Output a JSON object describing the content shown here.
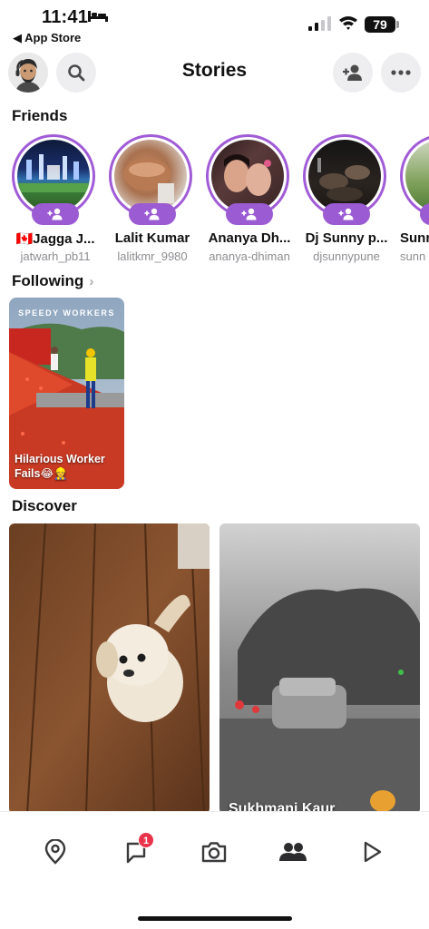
{
  "status_bar": {
    "time": "11:41",
    "back_label": "◀ App Store",
    "battery": "79"
  },
  "header": {
    "title": "Stories"
  },
  "friends_section": {
    "title": "Friends",
    "items": [
      {
        "name": "🇨🇦Jagga J...",
        "username": "jatwarh_pb11"
      },
      {
        "name": "Lalit Kumar",
        "username": "lalitkmr_9980"
      },
      {
        "name": "Ananya Dh...",
        "username": "ananya-dhiman"
      },
      {
        "name": "Dj Sunny p...",
        "username": "djsunnypune"
      },
      {
        "name": "Sunn",
        "username": "sunn"
      }
    ],
    "add_label": "+👤"
  },
  "following_section": {
    "title": "Following",
    "card": {
      "channel": "SPEEDY WORKERS",
      "caption": "Hilarious Worker Fails😂👷"
    }
  },
  "discover_section": {
    "title": "Discover",
    "cards": [
      {
        "caption": ""
      },
      {
        "caption": "Sukhmani Kaur"
      }
    ]
  },
  "bottom_nav": {
    "chat_badge": "1"
  },
  "colors": {
    "accent_purple": "#9b5bd3",
    "badge_red": "#e9334b"
  }
}
